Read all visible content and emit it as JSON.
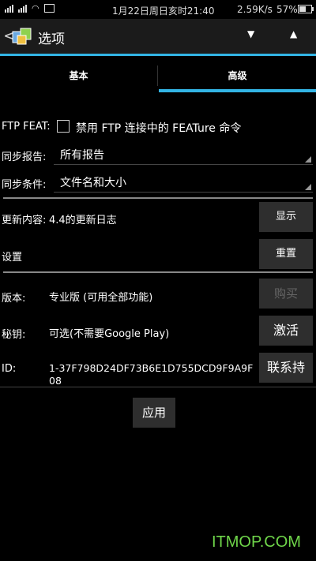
{
  "status": {
    "time": "1月22日周日亥时21:40",
    "speed": "2.59K/s",
    "battery": "57%"
  },
  "appbar": {
    "title": "选项",
    "back": "<"
  },
  "tabs": [
    {
      "label": "基本"
    },
    {
      "label": "高级"
    }
  ],
  "settings": {
    "ftp_feat_label": "FTP FEAT:",
    "ftp_feat_text": "禁用 FTP 连接中的 FEATure 命令",
    "sync_report_label": "同步报告:",
    "sync_report_value": "所有报告",
    "sync_cond_label": "同步条件:",
    "sync_cond_value": "文件名和大小",
    "update_label": "更新内容:",
    "update_value": "4.4的更新日志",
    "update_button": "显示",
    "settings_label": "设置",
    "reset_button": "重置",
    "version_label": "版本:",
    "version_value": "专业版 (可用全部功能)",
    "buy_button": "购买",
    "key_label": "秘钥:",
    "key_value": "可选(不需要Google Play)",
    "activate_button": "激活",
    "id_label": "ID:",
    "id_value": "1-37F798D24DF73B6E1D755DCD9F9A9F08",
    "support_button": "联系持",
    "apply_button": "应用"
  },
  "watermark": "ITMOP.COM"
}
